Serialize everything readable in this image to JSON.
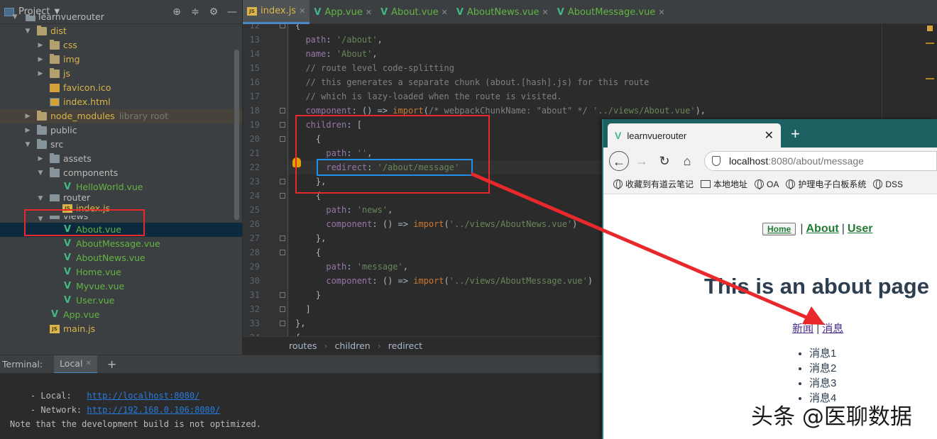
{
  "project_panel": {
    "title": "Project",
    "tree": [
      {
        "label": "learnvuerouter"
      },
      {
        "label": "dist"
      },
      {
        "label": "css"
      },
      {
        "label": "img"
      },
      {
        "label": "js"
      },
      {
        "label": "favicon.ico"
      },
      {
        "label": "index.html"
      },
      {
        "label": "node_modules",
        "tag": "library root"
      },
      {
        "label": "public"
      },
      {
        "label": "src"
      },
      {
        "label": "assets"
      },
      {
        "label": "components"
      },
      {
        "label": "HelloWorld.vue"
      },
      {
        "label": "router"
      },
      {
        "label": "index.js"
      },
      {
        "label": "views"
      },
      {
        "label": "About.vue"
      },
      {
        "label": "AboutMessage.vue"
      },
      {
        "label": "AboutNews.vue"
      },
      {
        "label": "Home.vue"
      },
      {
        "label": "Myvue.vue"
      },
      {
        "label": "User.vue"
      },
      {
        "label": "App.vue"
      },
      {
        "label": "main.js"
      }
    ]
  },
  "editor_tabs": [
    {
      "label": "index.js",
      "icon": "js-file-icon"
    },
    {
      "label": "App.vue",
      "icon": "vue-file-icon"
    },
    {
      "label": "About.vue",
      "icon": "vue-file-icon"
    },
    {
      "label": "AboutNews.vue",
      "icon": "vue-file-icon"
    },
    {
      "label": "AboutMessage.vue",
      "icon": "vue-file-icon"
    }
  ],
  "editor": {
    "line_numbers": [
      "12",
      "13",
      "14",
      "15",
      "16",
      "17",
      "18",
      "19",
      "20",
      "21",
      "22",
      "23",
      "24",
      "25",
      "26",
      "27",
      "28",
      "29",
      "30",
      "31",
      "32",
      "33",
      "34"
    ],
    "lines": [
      "{",
      "  path: '/about',",
      "  name: 'About',",
      "  // route level code-splitting",
      "  // this generates a separate chunk (about.[hash].js) for this route",
      "  // which is lazy-loaded when the route is visited.",
      "  component: () => import(/* webpackChunkName: \"about\" */ '../views/About.vue'),",
      "  children: [",
      "    {",
      "      path: '',",
      "      redirect: '/about/message'",
      "    },",
      "    {",
      "      path: 'news',",
      "      component: () => import('../views/AboutNews.vue')",
      "    },",
      "    {",
      "      path: 'message',",
      "      component: () => import('../views/AboutMessage.vue')",
      "    }",
      "  ]",
      "},",
      "{"
    ]
  },
  "breadcrumbs": [
    "routes",
    "children",
    "redirect"
  ],
  "terminal": {
    "title": "Terminal:",
    "tab": "Local",
    "local_label": "- Local:",
    "local_url": "http://localhost:8080/",
    "network_label": "- Network:",
    "network_url": "http://192.168.0.106:8080/",
    "note": "Note that the development build is not optimized."
  },
  "browser": {
    "tab_title": "learnvuerouter",
    "address_host": "localhost",
    "address_path": ":8080/about/message",
    "bookmarks": [
      "收藏到有道云笔记",
      "本地地址",
      "OA",
      "护理电子白板系统",
      "DSS"
    ],
    "nav": {
      "home": "Home",
      "about": "About",
      "user": "User"
    },
    "heading": "This is an about page",
    "sublinks": {
      "news": "新闻",
      "message": "消息"
    },
    "messages": [
      "消息1",
      "消息2",
      "消息3",
      "消息4"
    ]
  },
  "watermark": "头条 @医聊数据",
  "colors": {
    "annotation_red": "#e8282b",
    "annotation_blue": "#1f8fe8",
    "vue_green": "#41b883"
  }
}
